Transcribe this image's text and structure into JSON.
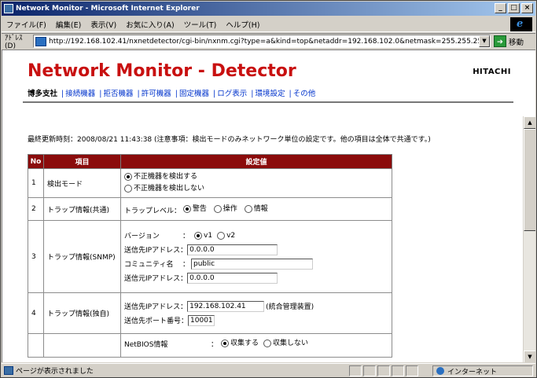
{
  "window": {
    "title": "Network Monitor - Microsoft Internet Explorer"
  },
  "menu": [
    "ファイル(F)",
    "編集(E)",
    "表示(V)",
    "お気に入り(A)",
    "ツール(T)",
    "ヘルプ(H)"
  ],
  "address": {
    "label": "ｱﾄﾞﾚｽ(D)",
    "url": "http://192.168.102.41/nxnetdetector/cgi-bin/nxnm.cgi?type=a&kind=top&netaddr=192.168.102.0&netmask=255.255.255.0",
    "go_label": "移動"
  },
  "page": {
    "title": "Network Monitor - Detector",
    "brand": "HITACHI",
    "nav": {
      "current": "博多支社",
      "links": [
        "接続機器",
        "拒否機器",
        "許可機器",
        "固定機器",
        "ログ表示",
        "環境設定",
        "その他"
      ]
    },
    "updated": "最終更新時刻：2008/08/21 11:43:38 (注意事項：検出モードのみネットワーク単位の設定です。他の項目は全体で共通です。)"
  },
  "table": {
    "headers": {
      "no": "No",
      "item": "項目",
      "value": "設定値"
    },
    "row1": {
      "no": "1",
      "item": "検出モード",
      "opt1": "不正機器を検出する",
      "opt2": "不正機器を検出しない"
    },
    "row2": {
      "no": "2",
      "item": "トラップ情報(共通)",
      "label": "トラップレベル：",
      "opt1": "警告",
      "opt2": "操作",
      "opt3": "情報"
    },
    "row3": {
      "no": "3",
      "item": "トラップ情報(SNMP)",
      "version_label": "バージョン",
      "version_sep": "：",
      "v1": "v1",
      "v2": "v2",
      "dest_label": "送信先IPアドレス：",
      "dest_value": "0.0.0.0",
      "community_label": "コミュニティ名",
      "community_sep": "：",
      "community_value": "public",
      "src_label": "送信元IPアドレス：",
      "src_value": "0.0.0.0"
    },
    "row4": {
      "no": "4",
      "item": "トラップ情報(独自)",
      "dest_label": "送信先IPアドレス：",
      "dest_value": "192.168.102.41",
      "dest_note": "(統合管理装置)",
      "port_label": "送信先ポート番号：",
      "port_value": "10001"
    },
    "row5": {
      "label": "NetBIOS情報",
      "sep": "：",
      "opt1": "収集する",
      "opt2": "収集しない"
    }
  },
  "status": {
    "text": "ページが表示されました",
    "zone": "インターネット"
  }
}
